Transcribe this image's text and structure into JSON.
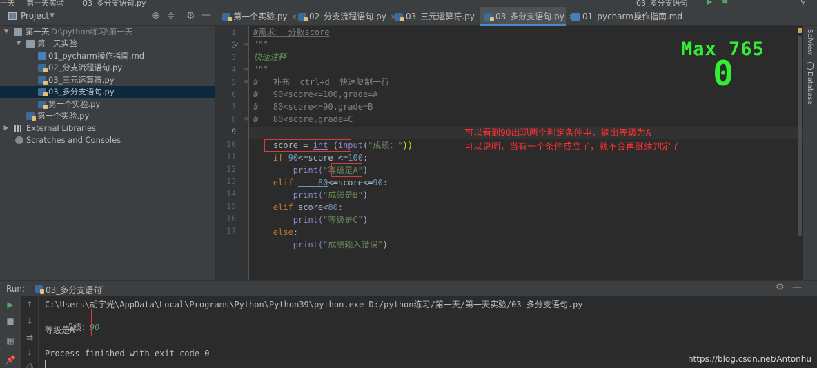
{
  "topbar": {
    "crumb_1": "一天",
    "crumb_2": "第一天实验",
    "crumb_3": "03_多分支语句.py",
    "run_config": "03_多分支语句"
  },
  "project": {
    "title": "Project",
    "tree": [
      {
        "label": "第一天",
        "suffix": "D:\\python练习\\第一天",
        "type": "folder",
        "expanded": true
      },
      {
        "label": "第一天实验",
        "type": "folder",
        "expanded": true
      },
      {
        "label": "01_pycharm操作指南.md",
        "type": "md"
      },
      {
        "label": "02_分支流程语句.py",
        "type": "py"
      },
      {
        "label": "03_三元运算符.py",
        "type": "py"
      },
      {
        "label": "03_多分支语句.py",
        "type": "py",
        "selected": true
      },
      {
        "label": "第一个实验.py",
        "type": "py"
      },
      {
        "label": "第一个实验.py",
        "type": "py"
      },
      {
        "label": "External Libraries",
        "type": "lib"
      },
      {
        "label": "Scratches and Consoles",
        "type": "scratch"
      }
    ]
  },
  "tabs": [
    {
      "label": "第一个实验.py"
    },
    {
      "label": "02_分支流程语句.py"
    },
    {
      "label": "03_三元运算符.py"
    },
    {
      "label": "03_多分支语句.py",
      "active": true
    },
    {
      "label": "01_pycharm操作指南.md"
    }
  ],
  "editor": {
    "line_numbers": [
      "1",
      "2",
      "3",
      "4",
      "5",
      "6",
      "7",
      "8",
      "9",
      "10",
      "11",
      "12",
      "13",
      "14",
      "15",
      "16",
      "17"
    ],
    "current_line": "9",
    "lines": {
      "l1": "#需求： 分数score",
      "l2": "\"\"\"",
      "l3": "快速注释",
      "l4": "\"\"\"",
      "l5": "#   补充  ctrl+d  快速复制一行",
      "l6": "#   90<score<=100,grade=A",
      "l7": "#   80<score<=90,grade=B",
      "l8": "#   80<score,grade=C",
      "l9a": "score = ",
      "l9b": "int",
      "l9c": " (",
      "l9d": "input",
      "l9e": "(",
      "l9f": "\"成绩：\"",
      "l9g": "))",
      "l10a": "if ",
      "l10b": "90",
      "l10c": "<=score <=",
      "l10d": "100",
      "l10e": ":",
      "l11a": "    print(",
      "l11b": "\"等级是A\"",
      "l11c": ")",
      "l12a": "elif ",
      "l12b": "    80",
      "l12c": "<=score<=",
      "l12d": "90",
      "l12e": ":",
      "l13a": "    print(",
      "l13b": "\"成绩是B\"",
      "l13c": ")",
      "l14a": "elif ",
      "l14b": "score<",
      "l14c": "80",
      "l14d": ":",
      "l15a": "    print(",
      "l15b": "\"等级是C\"",
      "l15c": ")",
      "l16a": "else",
      "l16b": ":",
      "l17a": "    print(",
      "l17b": "\"成绩输入错误\"",
      "l17c": ")"
    },
    "annotation_1": "可以看到90出现两个判定条件中，输出等级为A",
    "annotation_2": "可以说明，当有一个条件成立了，就不会再继续判定了",
    "overlay_max": "Max 765",
    "overlay_score": "0"
  },
  "right_strip": {
    "sciview": "SciView",
    "database": "Database"
  },
  "run": {
    "label": "Run:",
    "tab": "03_多分支语句",
    "cmd": "C:\\Users\\胡宇光\\AppData\\Local\\Programs\\Python\\Python39\\python.exe D:/python练习/第一天/第一天实验/03_多分支语句.py",
    "prompt": "成绩：",
    "input_value": "90",
    "output": "等级是A",
    "exit": "Process finished with exit code 0"
  },
  "watermark": "https://blog.csdn.net/Antonhu",
  "colors": {
    "accent": "#4a88c7",
    "annotation": "#ff3030",
    "overlay": "#33ee33"
  }
}
